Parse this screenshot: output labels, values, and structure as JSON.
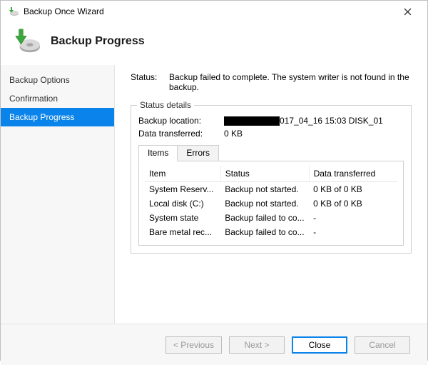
{
  "window": {
    "title": "Backup Once Wizard"
  },
  "header": {
    "heading": "Backup Progress"
  },
  "sidebar": {
    "items": [
      {
        "label": "Backup Options"
      },
      {
        "label": "Confirmation"
      },
      {
        "label": "Backup Progress"
      }
    ],
    "selected_index": 2
  },
  "content": {
    "status_label": "Status:",
    "status_message": "Backup failed to complete. The system writer is not found in the backup.",
    "group_title": "Status details",
    "backup_location_label": "Backup location:",
    "backup_location_value_suffix": "017_04_16 15:03 DISK_01",
    "data_transferred_label": "Data transferred:",
    "data_transferred_value": "0 KB",
    "tabs": [
      {
        "label": "Items"
      },
      {
        "label": "Errors"
      }
    ],
    "active_tab_index": 0,
    "columns": {
      "item": "Item",
      "status": "Status",
      "data_transferred": "Data transferred"
    },
    "rows": [
      {
        "item": "System Reserv...",
        "status": "Backup not started.",
        "data": "0 KB of 0 KB"
      },
      {
        "item": "Local disk (C:)",
        "status": "Backup not started.",
        "data": "0 KB of 0 KB"
      },
      {
        "item": "System state",
        "status": "Backup failed to co...",
        "data": "-"
      },
      {
        "item": "Bare metal rec...",
        "status": "Backup failed to co...",
        "data": "-"
      }
    ]
  },
  "footer": {
    "previous": "< Previous",
    "next": "Next >",
    "close": "Close",
    "cancel": "Cancel"
  }
}
